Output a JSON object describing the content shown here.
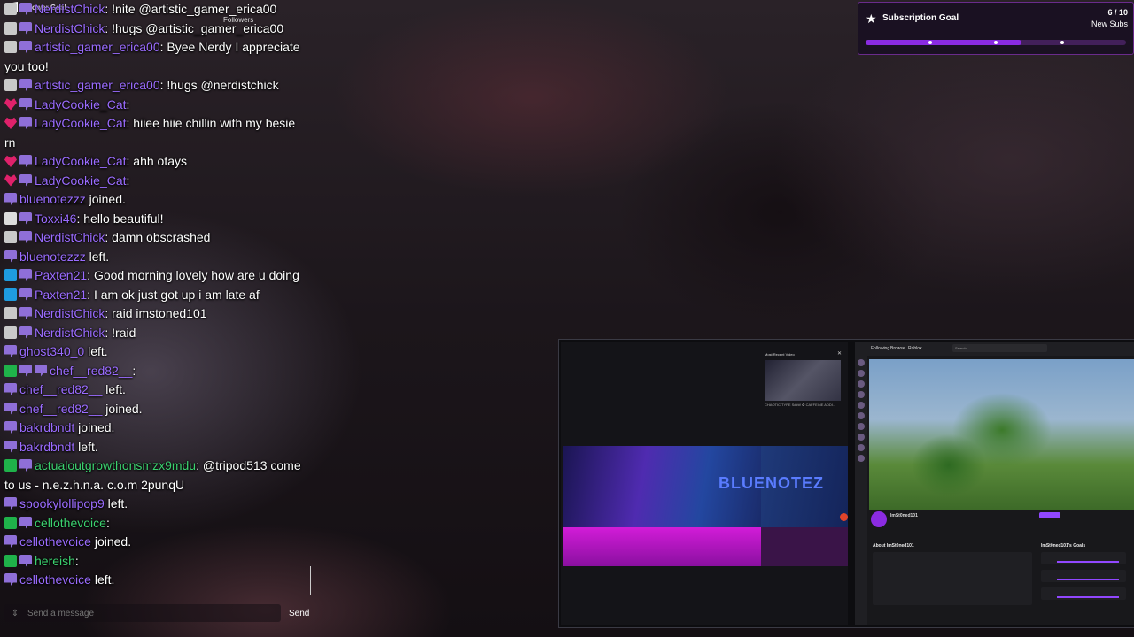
{
  "overlay": {
    "top_label": "follower Goal",
    "followers_label": "Followers"
  },
  "chat": {
    "messages": [
      {
        "badges": [
          "bot"
        ],
        "user": "NerdistChick",
        "text": ": !nite @artistic_gamer_erica00"
      },
      {
        "badges": [
          "bot"
        ],
        "user": "NerdistChick",
        "text": ": !hugs @artistic_gamer_erica00"
      },
      {
        "badges": [
          "bot"
        ],
        "user": "artistic_gamer_erica00",
        "text": ": Byee Nerdy I appreciate"
      },
      {
        "badges": [],
        "user": "",
        "text": "you too!"
      },
      {
        "badges": [
          "bot"
        ],
        "user": "artistic_gamer_erica00",
        "text": ": !hugs @nerdistchick"
      },
      {
        "badges": [
          "vip"
        ],
        "user": "LadyCookie_Cat",
        "text": ":"
      },
      {
        "badges": [
          "vip"
        ],
        "user": "LadyCookie_Cat",
        "text": ": hiiee hiie chillin with my besie"
      },
      {
        "badges": [],
        "user": "",
        "text": "rn"
      },
      {
        "badges": [
          "vip"
        ],
        "user": "LadyCookie_Cat",
        "text": ": ahh otays"
      },
      {
        "badges": [
          "vip"
        ],
        "user": "LadyCookie_Cat",
        "text": ":"
      },
      {
        "badges": [],
        "user": "bluenotezzz",
        "text": " joined."
      },
      {
        "badges": [
          "verified"
        ],
        "user": "Toxxi46",
        "text": ": hello beautiful!"
      },
      {
        "badges": [
          "bot"
        ],
        "user": "NerdistChick",
        "text": ": damn obscrashed"
      },
      {
        "badges": [],
        "user": "bluenotezzz",
        "text": " left."
      },
      {
        "badges": [
          "prime"
        ],
        "user": "Paxten21",
        "text": ": Good morning lovely how are u doing"
      },
      {
        "badges": [
          "prime"
        ],
        "user": "Paxten21",
        "text": ": I am ok just got up i am late af"
      },
      {
        "badges": [
          "bot"
        ],
        "user": "NerdistChick",
        "text": ": raid imstoned101"
      },
      {
        "badges": [
          "bot"
        ],
        "user": "NerdistChick",
        "text": ": !raid"
      },
      {
        "badges": [],
        "user": "ghost340_0",
        "text": " left."
      },
      {
        "badges": [
          "mod",
          "sub"
        ],
        "user": "chef__red82__",
        "text": ":"
      },
      {
        "badges": [],
        "user": "chef__red82__",
        "text": " left."
      },
      {
        "badges": [],
        "user": "chef__red82__",
        "text": " joined."
      },
      {
        "badges": [],
        "user": "bakrdbndt",
        "text": " joined."
      },
      {
        "badges": [],
        "user": "bakrdbndt",
        "text": " left."
      },
      {
        "badges": [
          "mod"
        ],
        "user": "actualoutgrowthonsmzx9mdu",
        "text": ": @tripod513 come"
      },
      {
        "badges": [],
        "user": "",
        "text": "to us - n.e.z.h.n.a. c.o.m 2punqU"
      },
      {
        "badges": [],
        "user": "spookylollipop9",
        "text": " left."
      },
      {
        "badges": [
          "mod"
        ],
        "user": "cellothevoice",
        "text": ":"
      },
      {
        "badges": [],
        "user": "cellothevoice",
        "text": " joined."
      },
      {
        "badges": [
          "mod"
        ],
        "user": "hereish",
        "text": ":"
      },
      {
        "badges": [],
        "user": "cellothevoice",
        "text": " left."
      }
    ],
    "input_placeholder": "Send a message",
    "send_label": "Send"
  },
  "sub_goal": {
    "title": "Subscription Goal",
    "count": "6 / 10",
    "unit": "New Subs",
    "progress": 0.6
  },
  "capture": {
    "recent_title": "Most Recent Video",
    "recent_caption": "CHAOTIC TYPE S###! ✿ CAFFEINE ADDI...",
    "banner_text": "BLUENOTEZ",
    "tw_nav": [
      "Following",
      "Browse",
      "Roblox"
    ],
    "tw_search": "Search",
    "channel_name": "ImSt0ned101",
    "about_title": "About ImSt0ned101",
    "goals_title": "ImSt0ned101's Goals"
  },
  "colors": {
    "accent": "#9147ff",
    "username": "#9b6cff",
    "goal_fill": "#8a2be2"
  }
}
